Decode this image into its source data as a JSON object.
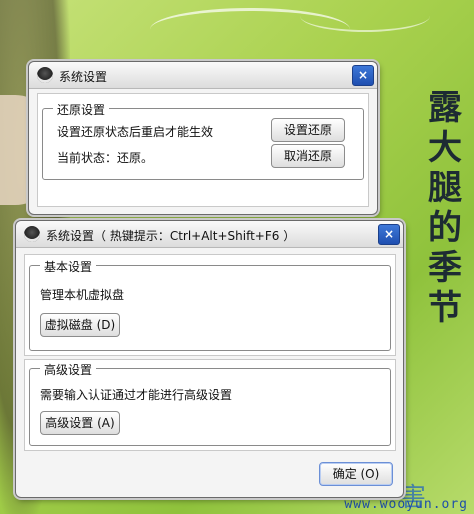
{
  "wallpaper": {
    "vertical_text": [
      "露",
      "大",
      "腿",
      "的",
      "季",
      "节"
    ],
    "watermark": "www.wooyun.org",
    "bottom_char": "害"
  },
  "restore_dialog": {
    "title": "系统设置",
    "close_label": "×",
    "group_title": "还原设置",
    "description": "设置还原状态后重启才能生效",
    "current_status": "当前状态：还原。",
    "set_restore_button": "设置还原",
    "cancel_restore_button": "取消还原"
  },
  "main_dialog": {
    "title": "系统设置（ 热键提示：Ctrl+Alt+Shift+F6 ）",
    "close_label": "×",
    "basic_group": {
      "title": "基本设置",
      "description": "管理本机虚拟盘",
      "button": "虚拟磁盘 (D)"
    },
    "advanced_group": {
      "title": "高级设置",
      "description": "需要输入认证通过才能进行高级设置",
      "button": "高级设置 (A)"
    },
    "ok_button": "确定 (O)"
  },
  "colors": {
    "close_button": "#2a5fc4",
    "wallpaper_green": "#a9d14e"
  }
}
